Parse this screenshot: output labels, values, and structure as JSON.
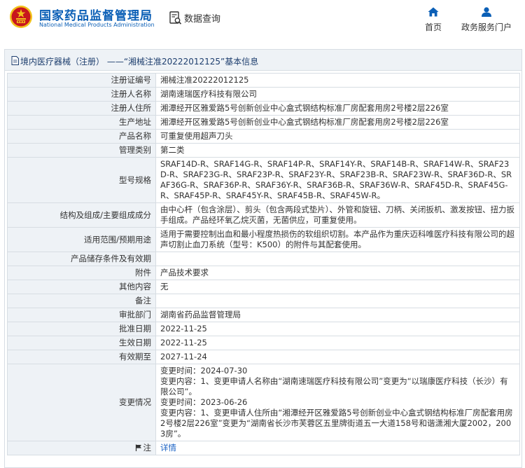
{
  "header": {
    "brand_cn": "国家药品监督管理局",
    "brand_en": "National Medical Products Administration",
    "page_title": "数据查询",
    "nav_home": "首页",
    "nav_services": "政务服务门户"
  },
  "colors": {
    "brand": "#0b5fb6",
    "emblem_red": "#c8161d",
    "emblem_gold": "#f2c21b",
    "table_border": "#d7dde3",
    "label_bg": "#eef2f6",
    "link": "#1a62c4"
  },
  "panel": {
    "title": "境内医疗器械（注册） ——“湘械注准20222012125”基本信息"
  },
  "rows": {
    "reg_no": {
      "label": "注册证编号",
      "value": "湘械注准20222012125"
    },
    "registrant": {
      "label": "注册人名称",
      "value": "湖南速瑞医疗科技有限公司"
    },
    "reg_address": {
      "label": "注册人住所",
      "value": "湘潭经开区雅爱路5号创新创业中心盒式钢结构标准厂房配套用房2号楼2层226室"
    },
    "prod_address": {
      "label": "生产地址",
      "value": "湘潭经开区雅爱路5号创新创业中心盒式钢结构标准厂房配套用房2号楼2层226室"
    },
    "product_name": {
      "label": "产品名称",
      "value": "可重复使用超声刀头"
    },
    "category": {
      "label": "管理类别",
      "value": "第二类"
    },
    "models": {
      "label": "型号规格",
      "value": "SRAF14D-R、SRAF14G-R、SRAF14P-R、SRAF14Y-R、SRAF14B-R、SRAF14W-R、SRAF23D-R、SRAF23G-R、SRAF23P-R、SRAF23Y-R、SRAF23B-R、SRAF23W-R、SRAF36D-R、SRAF36G-R、SRAF36P-R、SRAF36Y-R、SRAF36B-R、SRAF36W-R、SRAF45D-R、SRAF45G-R、SRAF45P-R、SRAF45Y-R、SRAF45B-R、SRAF45W-R。"
    },
    "composition": {
      "label": "结构及组成/主要组成成分",
      "value": "由中心杆（包含涂层）、剪头（包含两段式垫片）、外管和旋钮、刀柄、关闭扳机、激发按钮、扭力扳手组成。产品经环氧乙烷灭菌，无菌供应，可重复使用。"
    },
    "scope": {
      "label": "适用范围/预期用途",
      "value": "适用于需要控制出血和最小程度热损伤的软组织切割。本产品作为重庆迈科唯医疗科技有限公司的超声切割止血刀系统（型号：K500）的附件与其配套使用。"
    },
    "storage": {
      "label": "产品储存条件及有效期",
      "value": ""
    },
    "attachment": {
      "label": "附件",
      "value": "产品技术要求"
    },
    "other": {
      "label": "其他内容",
      "value": "无"
    },
    "remark": {
      "label": "备注",
      "value": ""
    },
    "authority": {
      "label": "审批部门",
      "value": "湖南省药品监督管理局"
    },
    "approve_date": {
      "label": "批准日期",
      "value": "2022-11-25"
    },
    "effect_date": {
      "label": "生效日期",
      "value": "2022-11-25"
    },
    "expiry_date": {
      "label": "有效期至",
      "value": "2027-11-24"
    },
    "changes": {
      "label": "变更情况",
      "lines": [
        "变更时间：2024-07-30",
        "变更内容：1、变更申请人名称由“湖南速瑞医疗科技有限公司”变更为“以瑞康医疗科技（长沙）有限公司”。",
        "变更时间：2023-06-26",
        "变更内容：1、变更申请人住所由“湘潭经开区雅爱路5号创新创业中心盒式钢结构标准厂房配套用房2号楼2层226室”变更为“湖南省长沙市芙蓉区五里牌街道五一大道158号和谐潇湘大厦2002，2003房”。"
      ]
    },
    "note": {
      "label": "注",
      "value": "详情"
    }
  }
}
